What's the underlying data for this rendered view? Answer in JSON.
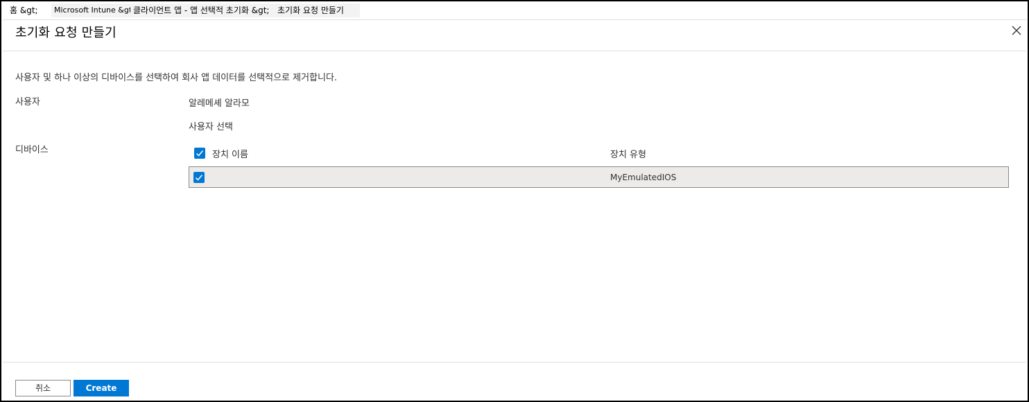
{
  "breadcrumb": [
    "홈 &gt;",
    "Microsoft Intune &gt;",
    "클라이언트 앱 - 앱 선택적 초기화 &gt;",
    "초기화 요청 만들기"
  ],
  "page": {
    "title": "초기화 요청 만들기",
    "description": "사용자 및 하나 이상의 디바이스를 선택하여 회사 앱 데이터를 선택적으로 제거합니다."
  },
  "user_section": {
    "label": "사용자",
    "value": "알레메셰 알라모",
    "select_link": "사용자 선택"
  },
  "device_section": {
    "label": "디바이스",
    "columns": [
      "장치 이름",
      "장치 유형"
    ],
    "header_checked": true,
    "rows": [
      {
        "name": "",
        "type": "MyEmulatedIOS",
        "checked": true
      }
    ]
  },
  "footer": {
    "cancel_label": "취소",
    "create_label": "Create"
  },
  "colors": {
    "accent": "#0078d4",
    "row_selected": "#edebe9",
    "divider": "#e1dfdd"
  },
  "icons": {
    "close": "close-icon",
    "check": "checkmark-icon"
  }
}
